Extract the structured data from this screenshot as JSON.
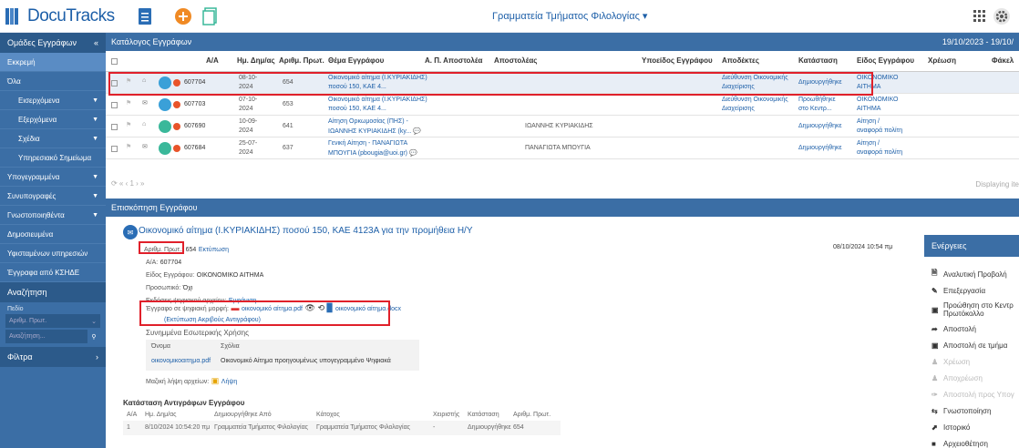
{
  "app": {
    "logo": "DocuTracks",
    "department": "Γραμματεία Τμήματος Φιλολογίας ▾"
  },
  "sidebar": {
    "header": "Ομάδες Εγγράφων",
    "collapse": "«",
    "items": [
      {
        "label": "Εκκρεμή",
        "active": true
      },
      {
        "label": "Όλα"
      },
      {
        "label": "Εισερχόμενα",
        "sub": true,
        "arrow": "▼"
      },
      {
        "label": "Εξερχόμενα",
        "sub": true,
        "arrow": "▼"
      },
      {
        "label": "Σχέδια",
        "sub": true,
        "arrow": "▼"
      },
      {
        "label": "Υπηρεσιακό Σημείωμα",
        "sub": true
      },
      {
        "label": "Υπογεγραμμένα",
        "arrow": "▼"
      },
      {
        "label": "Συνυπογραφές",
        "arrow": "▼"
      },
      {
        "label": "Γνωστοποιηθέντα",
        "arrow": "▼"
      },
      {
        "label": "Δημοσιευμένα"
      },
      {
        "label": "Υφισταμένων υπηρεσιών"
      },
      {
        "label": "Έγγραφα από ΚΣΗΔΕ"
      }
    ],
    "search_header": "Αναζήτηση",
    "field_label": "Πεδίο",
    "field_value": "Αριθμ. Πρωτ.",
    "search_placeholder": "Αναζήτηση...",
    "filters": "Φίλτρα"
  },
  "list": {
    "title": "Κατάλογος Εγγράφων",
    "date_range": "19/10/2023 - 19/10/",
    "columns": [
      "A/A",
      "Ημ. Δημ/ας",
      "Αριθμ. Πρωτ.",
      "Θέμα Εγγράφου",
      "Α. Π. Αποστολέα",
      "Αποστολέας",
      "Υποείδος Εγγράφου",
      "Αποδέκτες",
      "Κατάσταση",
      "Είδος Εγγράφου",
      "Χρέωση",
      "Φάκελ"
    ],
    "rows": [
      {
        "id": "607704",
        "date1": "08-10-",
        "date2": "2024",
        "prot": "654",
        "subj1": "Οικονομικό αίτημα (Ι.ΚΥΡΙΑΚΙΔΗΣ)",
        "subj2": "ποσού 150, ΚΑΕ 4...",
        "sender": "",
        "rec1": "Διεύθυνση Οικονομικής",
        "rec2": "Διαχείρισης",
        "status1": "Δημιουργήθηκε",
        "status2": "",
        "type1": "ΟΙΚΟΝΟΜΙΚΟ",
        "type2": "ΑΙΤΗΜΑ",
        "color": "#3aa0d8"
      },
      {
        "id": "607703",
        "date1": "07-10-",
        "date2": "2024",
        "prot": "653",
        "subj1": "Οικονομικό αίτημα (Ι.ΚΥΡΙΑΚΙΔΗΣ)",
        "subj2": "ποσού 150, ΚΑΕ 4...",
        "sender": "",
        "rec1": "Διεύθυνση Οικονομικής",
        "rec2": "Διαχείρισης",
        "status1": "Προωθήθηκε",
        "status2": "στο Κεντρ...",
        "type1": "ΟΙΚΟΝΟΜΙΚΟ",
        "type2": "ΑΙΤΗΜΑ",
        "color": "#3aa0d8"
      },
      {
        "id": "607690",
        "date1": "10-09-",
        "date2": "2024",
        "prot": "641",
        "subj1": "Αίτηση Ορκωμοσίας (ΠΗΣ) -",
        "subj2": "ΙΩΑΝΝΗΣ ΚΥΡΙΑΚΙΔΗΣ (ky... 💬",
        "sender": "ΙΩΑΝΝΗΣ ΚΥΡΙΑΚΙΔΗΣ",
        "rec1": "",
        "rec2": "",
        "status1": "Δημιουργήθηκε",
        "status2": "",
        "type1": "Αίτηση /",
        "type2": "αναφορά πολίτη",
        "color": "#3ab89a"
      },
      {
        "id": "607684",
        "date1": "25-07-",
        "date2": "2024",
        "prot": "637",
        "subj1": "Γενική Αίτηση - ΠΑΝΑΓΙΩΤΑ",
        "subj2": "ΜΠΟΥΓΙΑ (pbougia@uoi.gr) 💬",
        "sender": "ΠΑΝΑΓΙΩΤΑ ΜΠΟΥΓΙΑ",
        "rec1": "",
        "rec2": "",
        "status1": "Δημιουργήθηκε",
        "status2": "",
        "type1": "Αίτηση /",
        "type2": "αναφορά πολίτη",
        "color": "#3ab89a"
      }
    ],
    "pager": "⟳  « ‹  1  › »",
    "displaying": "Displaying ite"
  },
  "preview": {
    "title": "Επισκόπηση Εγγράφου",
    "doc_title": "Οικονομικό αίτημα (Ι.ΚΥΡΙΑΚΙΔΗΣ) ποσού 150, ΚΑΕ 4123Α για την προμήθεια Η/Υ",
    "prot_label": "Αριθμ. Πρωτ.:",
    "prot_value": "654",
    "print_link": "Εκτύπωση",
    "datetime": "08/10/2024 10:54 πμ",
    "aa_label": "Α/Α:",
    "aa_value": "607704",
    "type_label": "Είδος Εγγράφου:",
    "type_value": "ΟΙΚΟΝΟΜΙΚΟ ΑΙΤΗΜΑ",
    "personal_label": "Προσωπικό:",
    "personal_value": "Όχι",
    "versions_label": "Εκδόσεις ψηφιακού αρχείου:",
    "versions_value": "Εμφάνιση",
    "digital_label": "Έγγραφο σε ψηφιακή μορφή:",
    "file_pdf": "οικονομικό αίτημα.pdf",
    "file_docx": "οικονομικό αίτημα.docx",
    "exact_copy": "(Εκτύπωση Ακριβούς Αντιγράφου)",
    "attachments_label": "Συνημμένα Εσωτερικής Χρήσης",
    "att_cols": [
      "Όνομα",
      "Σχόλια"
    ],
    "att_file": "οικονομικοαιτημα.pdf",
    "att_comment": "Οικονομικό Αίτημα προηγουμένως υπογεγραμμένο Ψηφιακά",
    "bulk_label": "Μαζική λήψη αρχείων:",
    "bulk_value": "Λήψη",
    "copies_title": "Κατάσταση Αντιγράφων Εγγράφου",
    "copies_cols": [
      "Α/Α",
      "Ημ. Δημ/ας",
      "Δημιουργήθηκε Από",
      "Κάτοχος",
      "Χειριστής",
      "Κατάσταση",
      "Αριθμ. Πρωτ."
    ],
    "copies_row": [
      "1",
      "8/10/2024 10:54:20 πμ",
      "Γραμματεία Τμήματος Φιλολογίας",
      "Γραμματεία Τμήματος Φιλολογίας",
      "-",
      "Δημιουργήθηκε",
      "654"
    ]
  },
  "actions": {
    "title": "Ενέργειες",
    "items": [
      {
        "label": "Αναλυτική Προβολή",
        "icon": "🗎"
      },
      {
        "label": "Επεξεργασία",
        "icon": "✎"
      },
      {
        "label": "Προώθηση στο Κεντρ",
        "label2": "Πρωτόκολλο",
        "icon": "▣"
      },
      {
        "label": "Αποστολή",
        "icon": "➦"
      },
      {
        "label": "Αποστολή σε τμήμα",
        "icon": "▣"
      },
      {
        "label": "Χρέωση",
        "icon": "♟",
        "disabled": true
      },
      {
        "label": "Αποχρέωση",
        "icon": "♟",
        "disabled": true
      },
      {
        "label": "Αποστολή προς Υπογ",
        "icon": "✑",
        "disabled": true
      },
      {
        "label": "Γνωστοποίηση",
        "icon": "⇆"
      },
      {
        "label": "Ιστορικό",
        "icon": "⬈"
      },
      {
        "label": "Αρχειοθέτηση",
        "icon": "■"
      }
    ]
  }
}
